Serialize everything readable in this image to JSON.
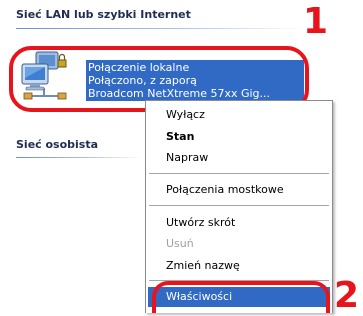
{
  "sections": {
    "lan_header": "Sieć LAN lub szybki Internet",
    "personal_header": "Sieć osobista"
  },
  "connection": {
    "name": "Połączenie lokalne",
    "status": "Połączono, z zaporą",
    "device": "Broadcom NetXtreme 57xx Gig...",
    "icon": "network-connection-icon"
  },
  "context_menu": {
    "items": [
      {
        "label": "Wyłącz",
        "style": "normal"
      },
      {
        "label": "Stan",
        "style": "bold"
      },
      {
        "label": "Napraw",
        "style": "normal"
      },
      {
        "label": "Połączenia mostkowe",
        "style": "normal"
      },
      {
        "label": "Utwórz skrót",
        "style": "normal"
      },
      {
        "label": "Usuń",
        "style": "disabled"
      },
      {
        "label": "Zmień nazwę",
        "style": "normal"
      },
      {
        "label": "Właściwości",
        "style": "selected"
      }
    ]
  },
  "annotations": {
    "step1": "1",
    "step2": "2"
  },
  "colors": {
    "selection": "#316ac5",
    "callout": "#e8141c"
  }
}
